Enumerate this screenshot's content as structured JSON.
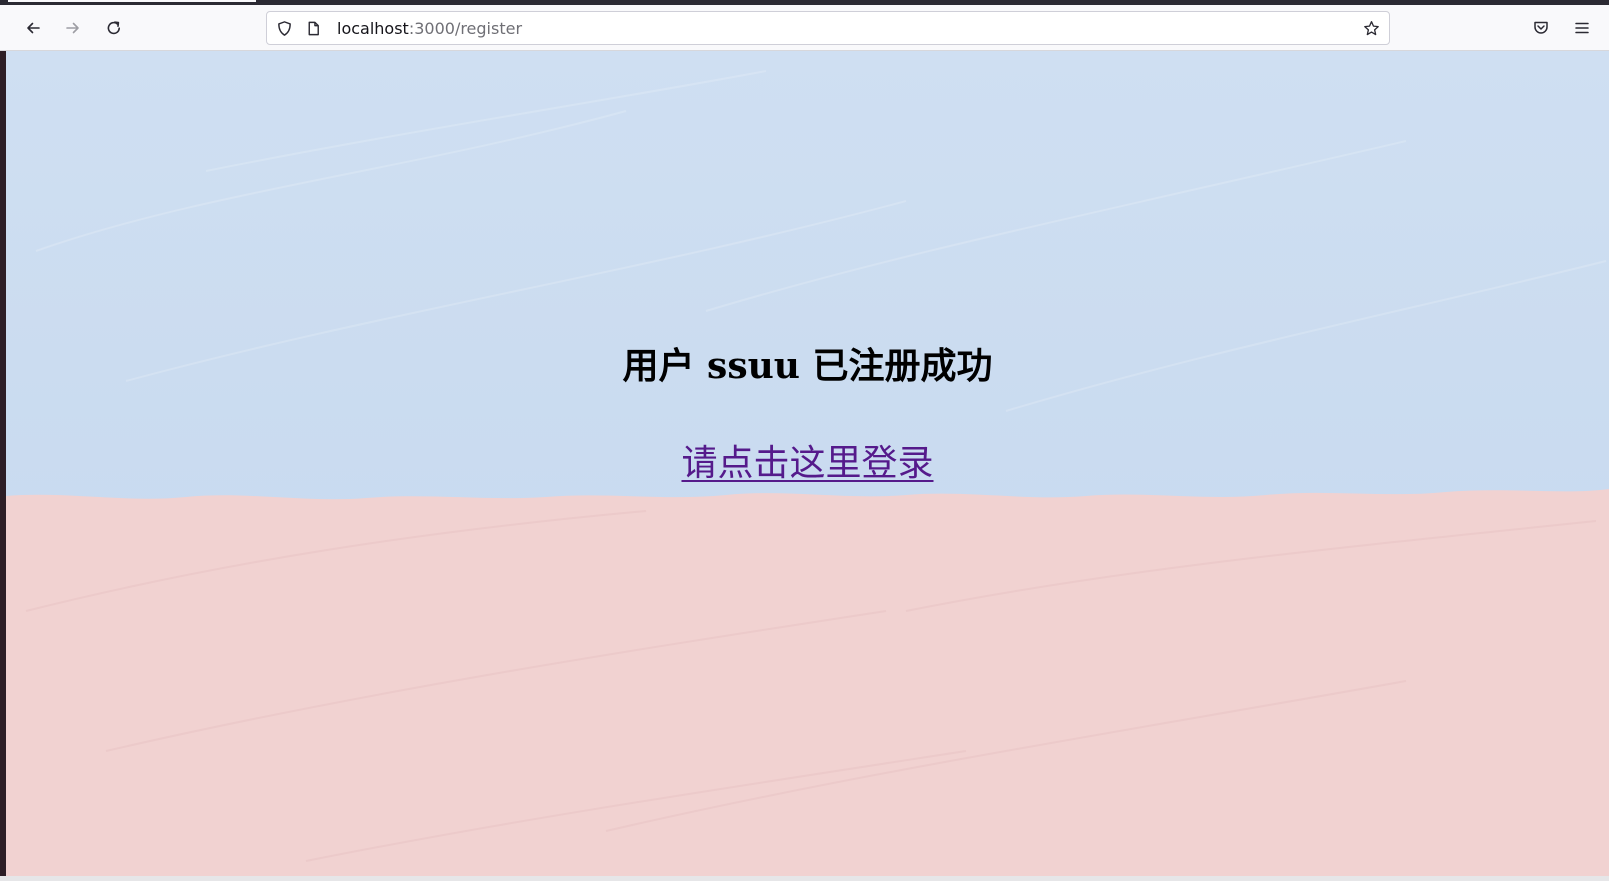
{
  "browser": {
    "url_host": "localhost",
    "url_path": ":3000/register",
    "icons": {
      "back": "arrow-left-icon",
      "forward": "arrow-right-icon",
      "reload": "reload-icon",
      "tracking": "shield-icon",
      "page": "page-icon",
      "bookmark": "star-icon",
      "pocket": "pocket-icon",
      "menu": "hamburger-menu-icon"
    }
  },
  "page": {
    "heading": "用户 ssuu 已注册成功",
    "login_link": "请点击这里登录"
  },
  "colors": {
    "sky": "#cbdcf0",
    "ground": "#f2d3d2",
    "link": "#551a8b",
    "heading": "#000000"
  }
}
